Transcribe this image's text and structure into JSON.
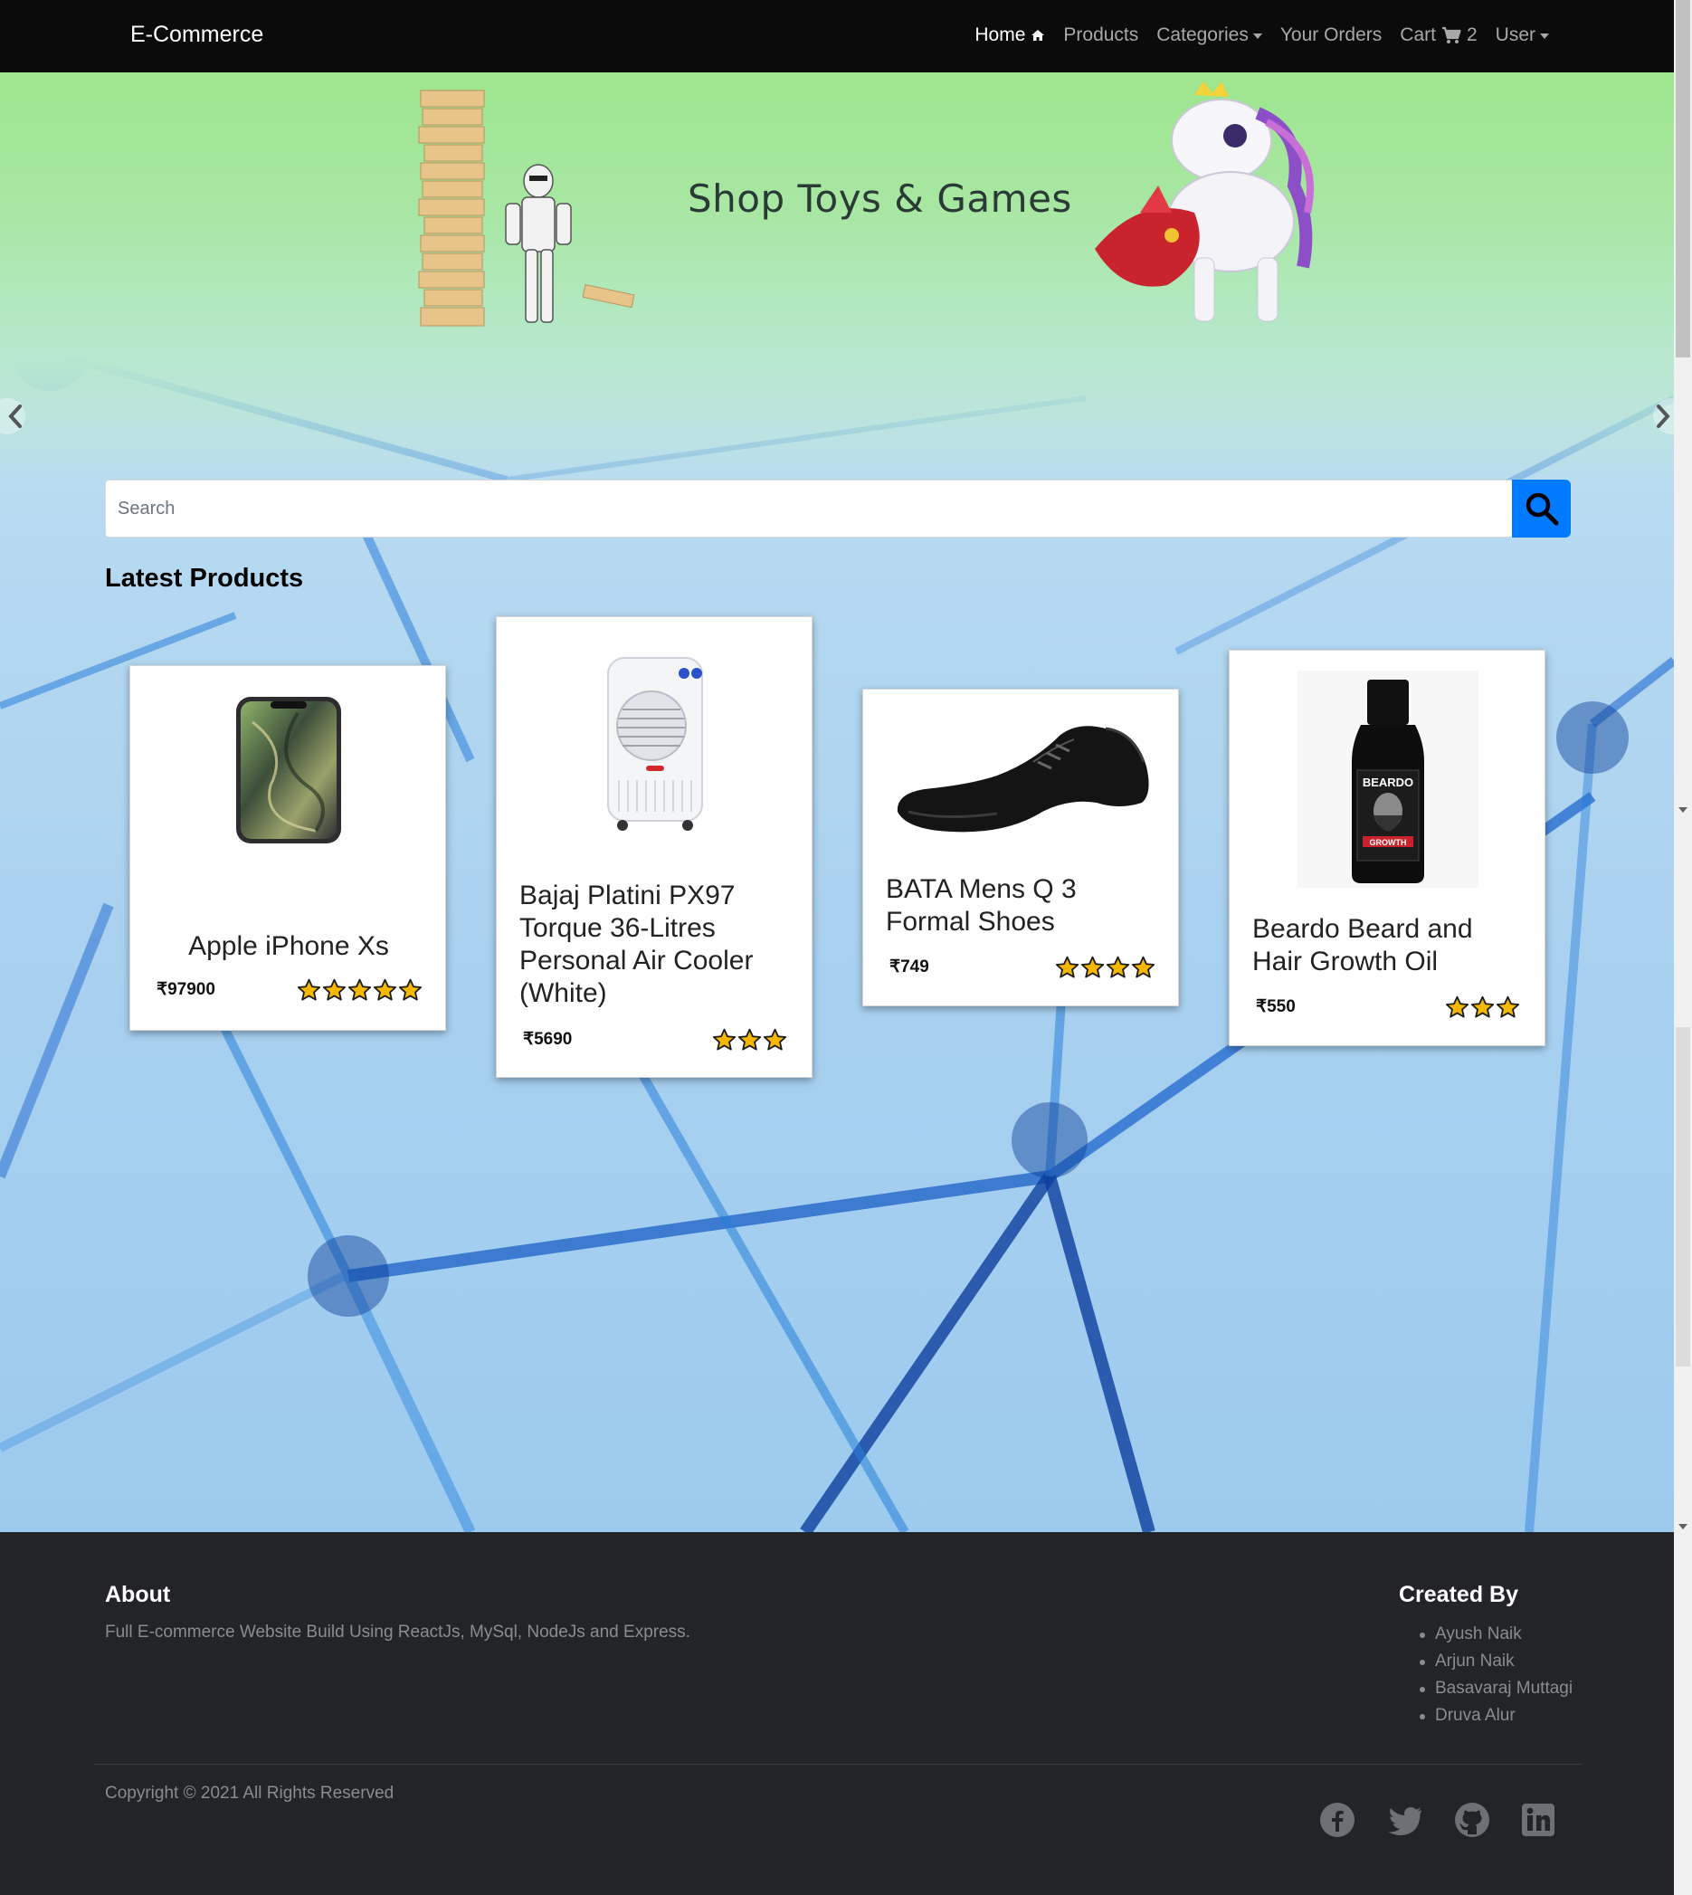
{
  "navbar": {
    "brand": "E-Commerce",
    "links": {
      "home": "Home",
      "products": "Products",
      "categories": "Categories",
      "orders": "Your Orders",
      "cart": "Cart",
      "cart_count": "2",
      "user": "User"
    }
  },
  "carousel": {
    "title": "Shop Toys & Games"
  },
  "search": {
    "placeholder": "Search"
  },
  "section": {
    "title": "Latest Products"
  },
  "products": [
    {
      "name": "Apple iPhone Xs",
      "price": "₹97900",
      "rating": 5
    },
    {
      "name": "Bajaj Platini PX97 Torque 36-Litres Personal Air Cooler (White)",
      "price": "₹5690",
      "rating": 3
    },
    {
      "name": "BATA Mens Q 3 Formal Shoes",
      "price": "₹749",
      "rating": 4
    },
    {
      "name": "Beardo Beard and Hair Growth Oil",
      "price": "₹550",
      "rating": 3
    }
  ],
  "footer": {
    "about_title": "About",
    "about_text": "Full E-commerce Website Build Using ReactJs, MySql, NodeJs and Express.",
    "created_title": "Created By",
    "creators": [
      "Ayush Naik",
      "Arjun Naik",
      "Basavaraj Muttagi",
      "Druva Alur"
    ],
    "copyright": "Copyright © 2021 All Rights Reserved"
  },
  "icons": {
    "home": "home-icon",
    "cart": "cart-icon",
    "search": "search-icon",
    "star": "star-icon",
    "social": [
      "facebook-icon",
      "twitter-icon",
      "github-icon",
      "linkedin-icon"
    ]
  },
  "colors": {
    "navbar_bg": "#0b0b0b",
    "accent": "#007bff",
    "footer_bg": "#232428",
    "star": "#f5b800"
  }
}
